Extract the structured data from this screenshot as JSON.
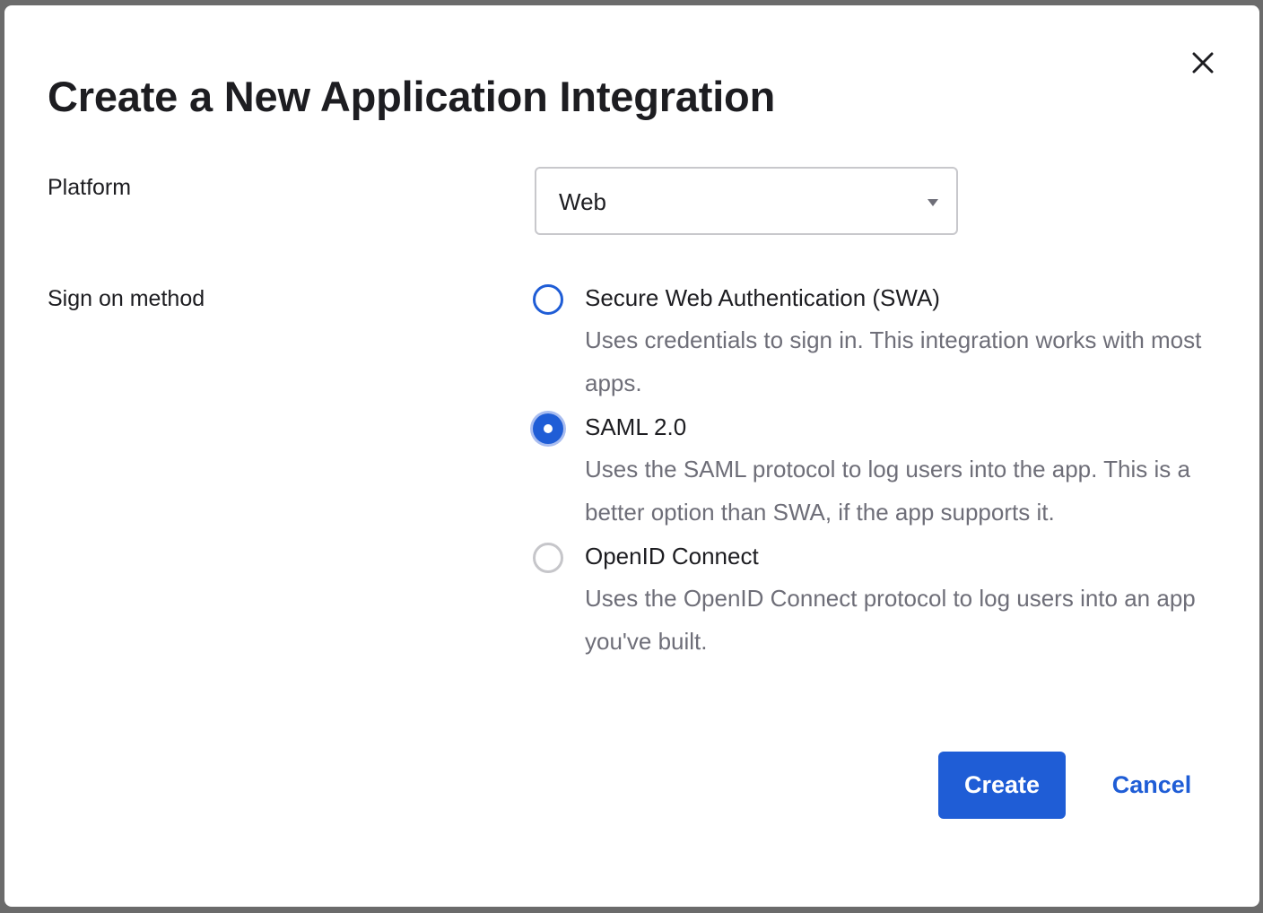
{
  "dialog": {
    "title": "Create a New Application Integration",
    "close_icon": "close-icon"
  },
  "platform": {
    "label": "Platform",
    "selected": "Web"
  },
  "sign_on": {
    "label": "Sign on method",
    "selected_index": 1,
    "options": [
      {
        "label": "Secure Web Authentication (SWA)",
        "description": "Uses credentials to sign in. This integration works with most apps.",
        "checked": false
      },
      {
        "label": "SAML 2.0",
        "description": "Uses the SAML protocol to log users into the app. This is a better option than SWA, if the app supports it.",
        "checked": true
      },
      {
        "label": "OpenID Connect",
        "description": "Uses the OpenID Connect protocol to log users into an app you've built.",
        "checked": false
      }
    ]
  },
  "actions": {
    "create_label": "Create",
    "cancel_label": "Cancel"
  },
  "colors": {
    "accent": "#1f5dd6",
    "text": "#1d1d21",
    "muted_text": "#6e6e78"
  }
}
